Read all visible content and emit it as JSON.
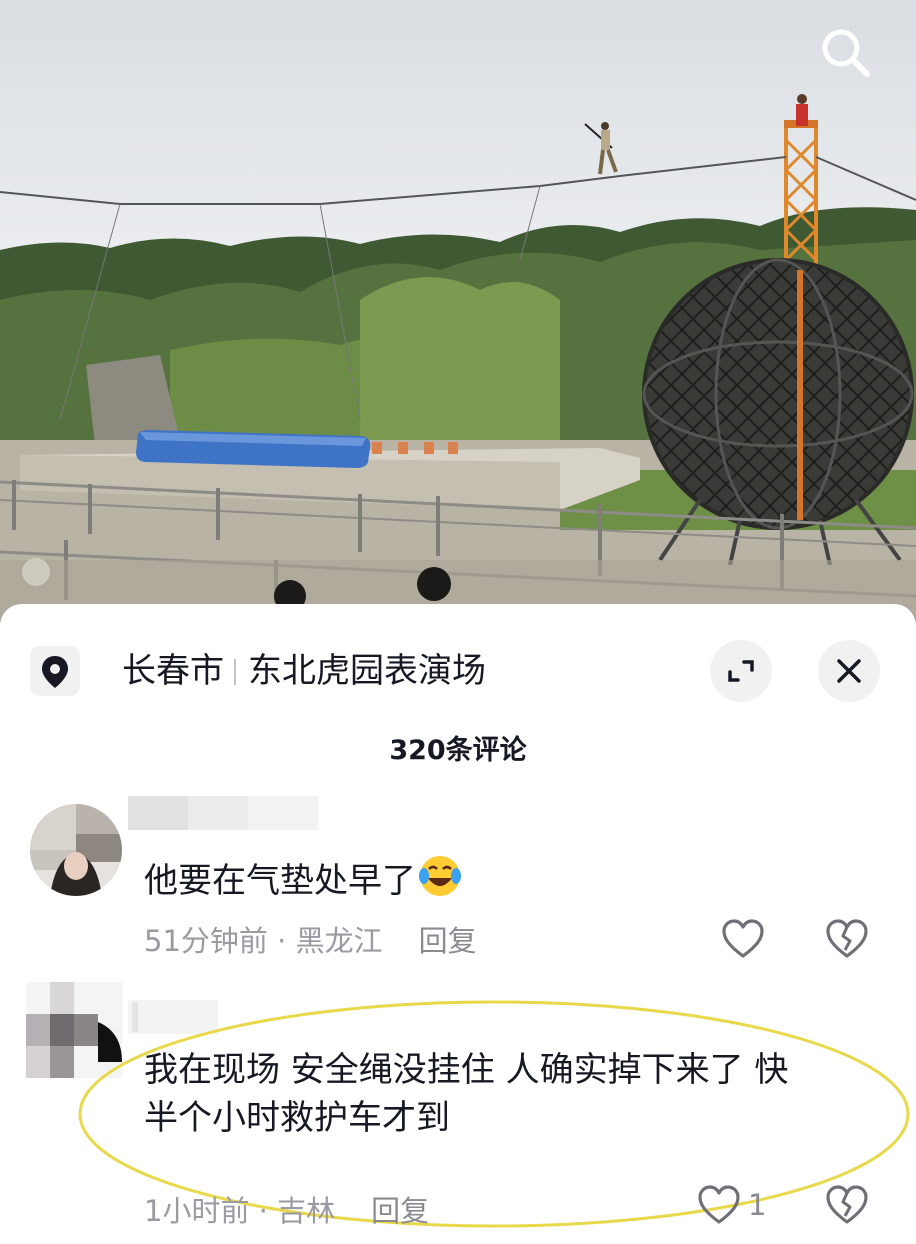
{
  "video": {
    "icons": {
      "search": "search-icon"
    }
  },
  "location": {
    "icon": "location-pin-icon",
    "city": "长春市",
    "place": "东北虎园表演场",
    "expand_icon": "expand-icon",
    "close_icon": "close-icon"
  },
  "comments_header": {
    "count_label": "320条评论"
  },
  "comments": [
    {
      "text": "他要在气垫处早了",
      "emoji": "laughing-crying-emoji",
      "time": "51分钟前",
      "region": "黑龙江",
      "reply_label": "回复",
      "like_count": "",
      "like_icon": "heart-icon",
      "dislike_icon": "broken-heart-icon"
    },
    {
      "text_line1": "我在现场 安全绳没挂住 人确实掉下来了 快",
      "text_line2": "半个小时救护车才到",
      "time": "1小时前",
      "region": "吉林",
      "reply_label": "回复",
      "like_count": "1",
      "like_icon": "heart-icon",
      "dislike_icon": "broken-heart-icon",
      "highlight_color": "#e8d84a"
    }
  ],
  "colors": {
    "text_primary": "#161823",
    "text_secondary": "#9a9ba2",
    "highlight": "#e8d84a",
    "button_bg": "#f1f1f2"
  }
}
